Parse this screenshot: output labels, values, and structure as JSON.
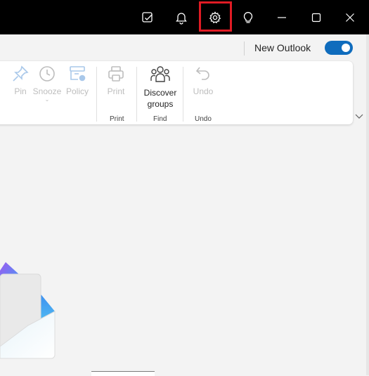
{
  "titlebar": {
    "buttons": [
      {
        "name": "notes-icon"
      },
      {
        "name": "bell-icon"
      },
      {
        "name": "gear-icon"
      },
      {
        "name": "lightbulb-icon"
      },
      {
        "name": "minimize-icon"
      },
      {
        "name": "maximize-icon"
      },
      {
        "name": "close-icon"
      }
    ],
    "highlight_color": "#e01b24"
  },
  "toggle": {
    "label": "New Outlook",
    "state": "on",
    "accent": "#0f6cbd"
  },
  "ribbon": {
    "buttons": {
      "pin": "Pin",
      "snooze": "Snooze",
      "policy": "Policy",
      "print": "Print",
      "discover_line1": "Discover",
      "discover_line2": "groups",
      "undo": "Undo"
    },
    "groups": {
      "print": "Print",
      "find": "Find",
      "undo": "Undo"
    }
  }
}
